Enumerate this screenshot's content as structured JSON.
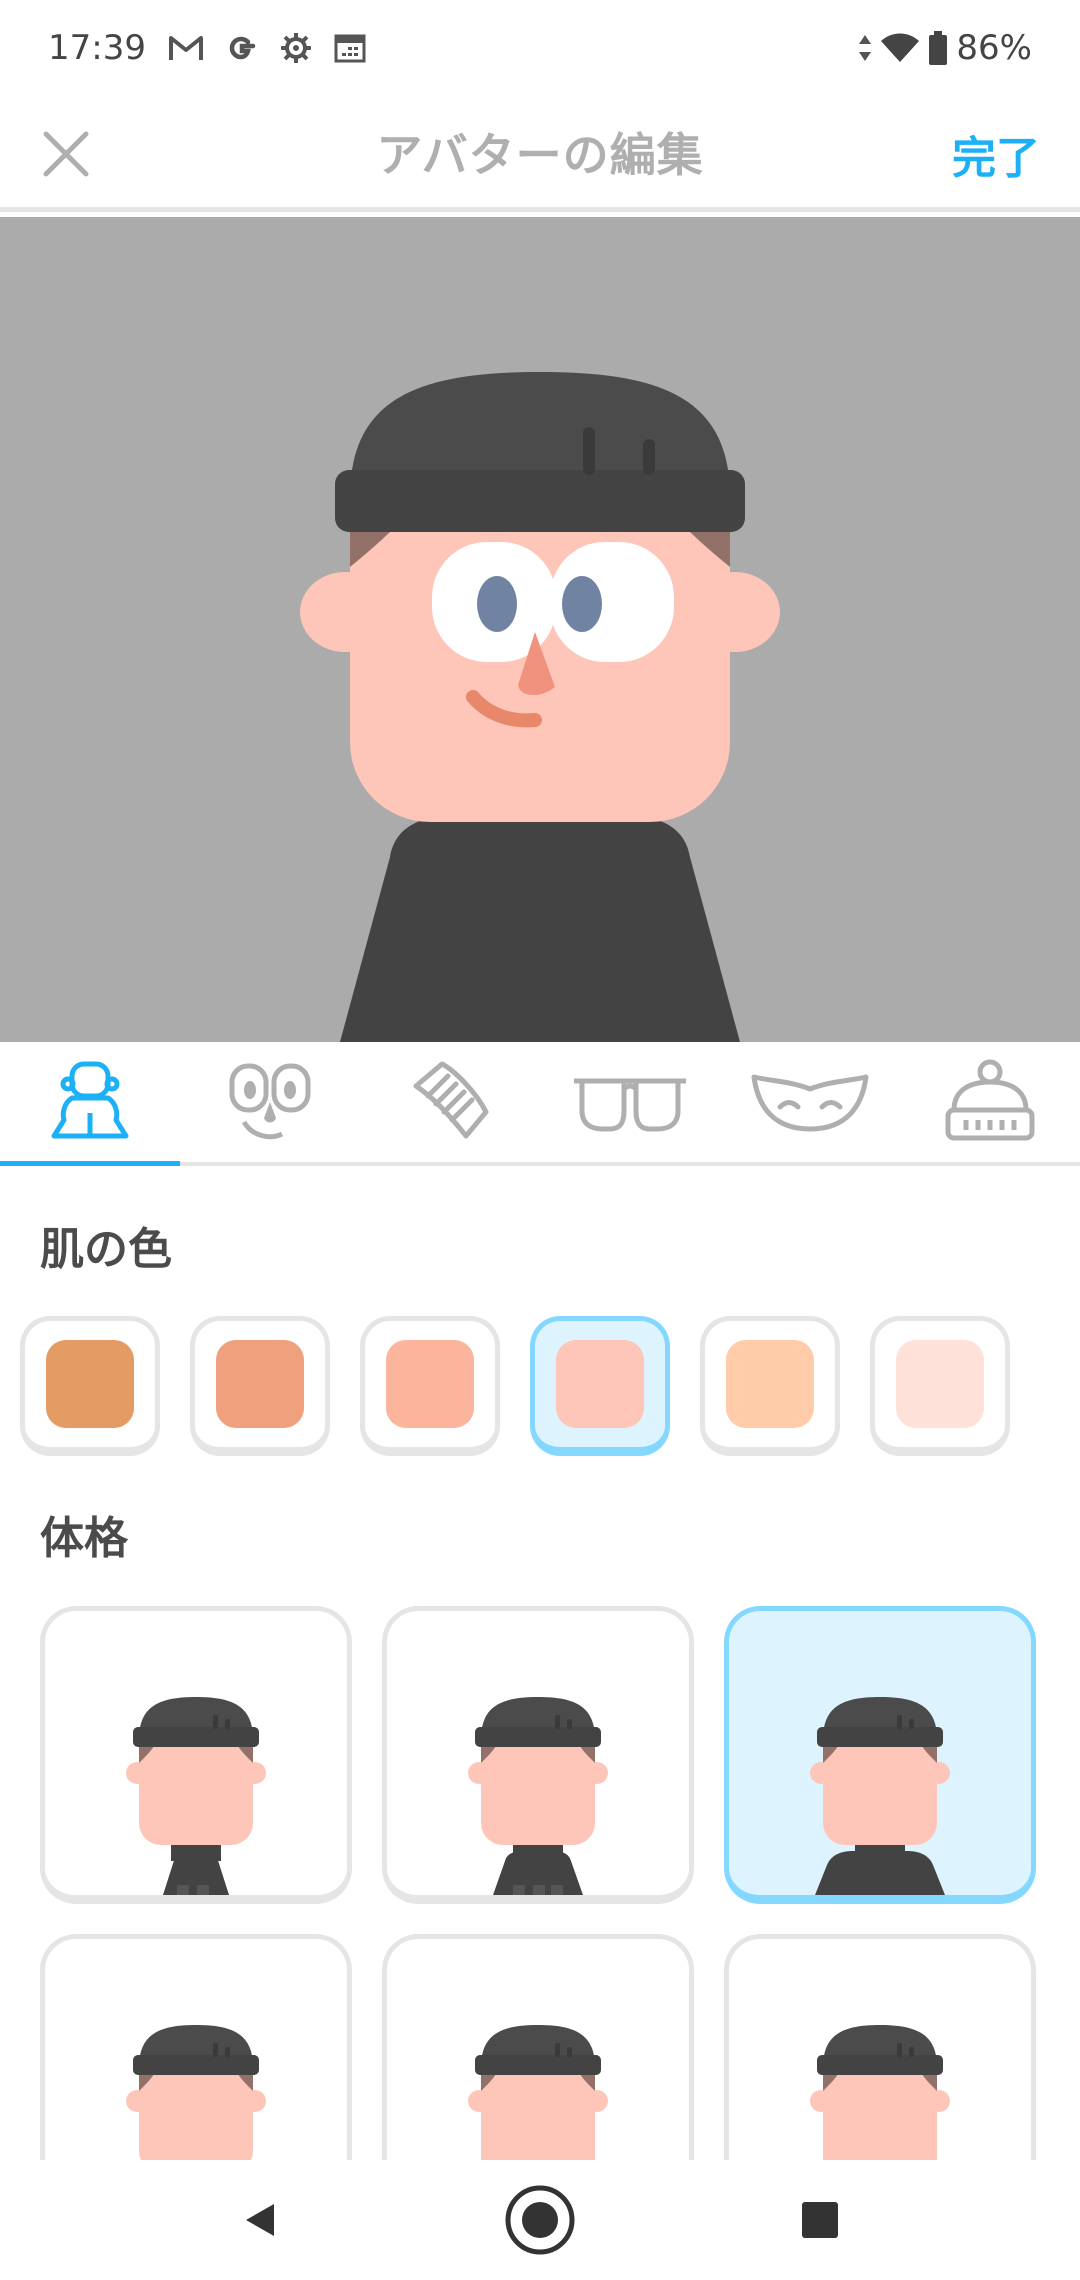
{
  "status_bar": {
    "time": "17:39",
    "battery": "86%",
    "icons": [
      "gmail-icon",
      "google-icon",
      "settings-icon",
      "calendar-icon",
      "data-arrows-icon",
      "wifi-icon",
      "battery-icon"
    ]
  },
  "header": {
    "title": "アバターの編集",
    "done_label": "完了",
    "close_icon": "close-icon"
  },
  "tabs": [
    {
      "name": "body-tab",
      "icon": "body-icon",
      "active": true
    },
    {
      "name": "face-tab",
      "icon": "face-icon",
      "active": false
    },
    {
      "name": "hair-tab",
      "icon": "comb-icon",
      "active": false
    },
    {
      "name": "glasses-tab",
      "icon": "glasses-icon",
      "active": false
    },
    {
      "name": "facial-hair-tab",
      "icon": "mustache-icon",
      "active": false
    },
    {
      "name": "hat-tab",
      "icon": "beanie-icon",
      "active": false
    }
  ],
  "skin_section": {
    "title": "肌の色",
    "colors": [
      "#e49b64",
      "#efa07c",
      "#fbb59d",
      "#fdc6b9",
      "#ffcba9",
      "#fee1d8"
    ],
    "selected_index": 3
  },
  "body_section": {
    "title": "体格",
    "selected_index": 2
  },
  "colors": {
    "accent": "#1cb0f6",
    "selected_border": "#84d8ff",
    "selected_bg": "#ddf4ff",
    "preview_bg": "#ababab",
    "beanie": "#4b4b4b",
    "shirt": "#434343",
    "hair": "#937169",
    "skin": "#fdc6b9"
  },
  "nav_bar": {
    "icons": [
      "back-icon",
      "home-icon",
      "recents-icon"
    ]
  }
}
